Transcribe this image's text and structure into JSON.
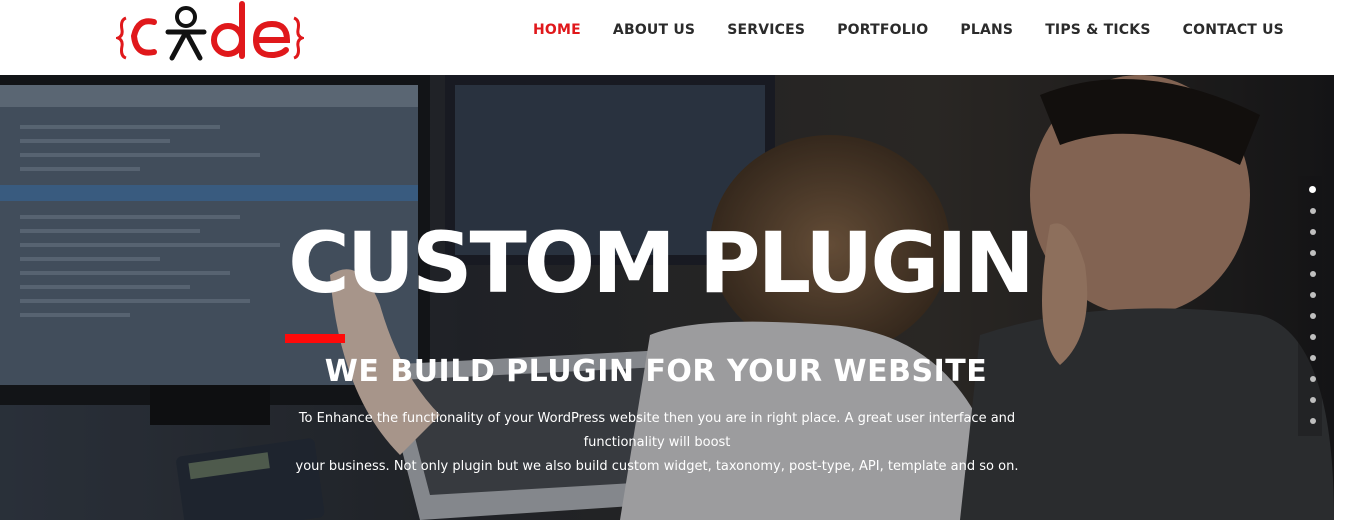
{
  "brand": {
    "logo_text": "code",
    "accent": "#e0181b"
  },
  "nav": {
    "items": [
      {
        "label": "HOME",
        "active": true
      },
      {
        "label": "ABOUT US",
        "active": false
      },
      {
        "label": "SERVICES",
        "active": false
      },
      {
        "label": "PORTFOLIO",
        "active": false
      },
      {
        "label": "PLANS",
        "active": false
      },
      {
        "label": "TIPS & TICKS",
        "active": false
      },
      {
        "label": "CONTACT US",
        "active": false
      }
    ]
  },
  "hero": {
    "title": "CUSTOM PLUGIN",
    "subtitle": "WE BUILD PLUGIN FOR YOUR WEBSITE",
    "description_line1": "To Enhance the functionality of your WordPress website then you are in right place. A great user interface and functionality will boost",
    "description_line2": "your business. Not only plugin but we also build custom widget, taxonomy, post-type, API, template and so on.",
    "slides_total": 12,
    "active_slide": 1
  }
}
